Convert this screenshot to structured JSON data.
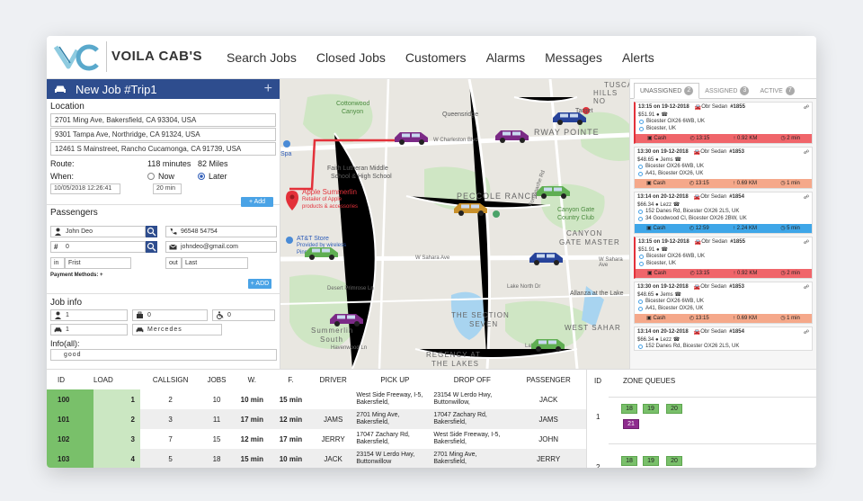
{
  "brand": "VOILA CAB'S",
  "nav": [
    "Search Jobs",
    "Closed Jobs",
    "Customers",
    "Alarms",
    "Messages",
    "Alerts"
  ],
  "newjob": {
    "title": "New Job #Trip1",
    "location_label": "Location",
    "addresses": [
      "2701 Ming Ave, Bakersfield, CA 93304, USA",
      "9301 Tampa Ave, Northridge, CA 91324, USA",
      "12461 S Mainstreet, Rancho Cucamonga, CA 91739, USA"
    ],
    "route_label": "Route:",
    "route_minutes": "118 minutes",
    "route_miles": "82 Miles",
    "when_label": "When:",
    "now_label": "Now",
    "later_label": "Later",
    "datetime": "10/05/2018  12:26:41",
    "minutes": "20 min",
    "add_label": "+ Add",
    "passengers_label": "Passengers",
    "name": "John Deo",
    "phone": "96548 54754",
    "count": "0",
    "email": "johndeo@gmail.com",
    "in_label": "in",
    "in_value": "Frist",
    "out_label": "out",
    "out_value": "Last",
    "payment_label": "Payment Methods: +",
    "add2_label": "+ ADD",
    "jobinfo_label": "Job info",
    "jobinfo_person": "1",
    "jobinfo_bag": "0",
    "jobinfo_wheel": "0",
    "jobinfo_car": "1",
    "jobinfo_model": "Mercedes",
    "info_label": "Info(all):",
    "info_value": "good"
  },
  "map": {
    "labels": [
      "TUSCA",
      "HILLS NO",
      "Cottonwood",
      "Canyon",
      "Queensridge",
      "Target",
      "RWAY POINTE",
      "W Charleston Blvd",
      "Faith Lutheran Middle",
      "School & High School",
      "PECCOLE RANCH",
      "Canyon Gate",
      "Country Club",
      "CANYON",
      "GATE MASTER",
      "Apple Summerlin",
      "Retailer of Apple",
      "products & accessories",
      "AT&T Store",
      "W Sahara Ave",
      "Desert Primrose Ln",
      "Lake North Dr",
      "Allanza at the Lake",
      "THE SECTION",
      "SEVEN",
      "WEST SAHAR",
      "Summerlin",
      "South",
      "Havenwood Ln",
      "REGENCY AT",
      "THE LAKES",
      "Lake South Dr",
      "Spa",
      "Fort Apache Rd",
      "Provided by wireless",
      "Pinnacle"
    ]
  },
  "tabs": [
    {
      "label": "UNASSIGNED",
      "count": "2"
    },
    {
      "label": "ASSIGNED",
      "count": "3"
    },
    {
      "label": "ACTIVE",
      "count": "7"
    }
  ],
  "cards": [
    {
      "time": "13:15 on 19-12-2018",
      "car": "Obr Sedan",
      "num": "#1855",
      "price": "$51.91",
      "p1": "Bicester OX26 6WB, UK",
      "p2": "Bicester, UK",
      "pay": "Cash",
      "eta": "13:15",
      "dist": "0.92 KM",
      "dur": "2 min",
      "color": "red"
    },
    {
      "time": "13:30 on 19-12-2018",
      "car": "Obr Sedan",
      "num": "#1853",
      "price": "$48.65",
      "who": "Jems",
      "p1": "Bicester OX26 6WB, UK",
      "p2": "A41, Bicester OX26, UK",
      "pay": "Cash",
      "eta": "13:15",
      "dist": "0.69 KM",
      "dur": "1 min",
      "color": "orange"
    },
    {
      "time": "13:14 on 20-12-2018",
      "car": "Obr Sedan",
      "num": "#1854",
      "price": "$66.34",
      "who": "Lezz",
      "p1": "152 Danes Rd, Bicester OX26 2LS, UK",
      "p2": "34 Goodwood Cl, Bicester OX26 2BW, UK",
      "pay": "Cash",
      "eta": "12:59",
      "dist": "2.24 KM",
      "dur": "5 min",
      "color": "blue"
    },
    {
      "time": "13:15 on 19-12-2018",
      "car": "Obr Sedan",
      "num": "#1855",
      "price": "$51.91",
      "p1": "Bicester OX26 6WB, UK",
      "p2": "Bicester, UK",
      "pay": "Cash",
      "eta": "13:15",
      "dist": "0.92 KM",
      "dur": "2 min",
      "color": "red"
    },
    {
      "time": "13:30 on 19-12-2018",
      "car": "Obr Sedan",
      "num": "#1853",
      "price": "$48.65",
      "who": "Jems",
      "p1": "Bicester OX26 6WB, UK",
      "p2": "A41, Bicester OX26, UK",
      "pay": "Cash",
      "eta": "13:15",
      "dist": "0.69 KM",
      "dur": "1 min",
      "color": "orange"
    },
    {
      "time": "13:14 on 20-12-2018",
      "car": "Obr Sedan",
      "num": "#1854",
      "price": "$66.34",
      "who": "Lezz",
      "p1": "152 Danes Rd, Bicester OX26 2LS, UK",
      "p2": "",
      "pay": "",
      "eta": "",
      "dist": "",
      "dur": "",
      "color": "none"
    }
  ],
  "table": {
    "headers": [
      "ID",
      "LOAD",
      "CALLSIGN",
      "JOBS",
      "W.",
      "F.",
      "DRIVER",
      "PICK UP",
      "DROP OFF",
      "PASSENGER"
    ],
    "rows": [
      {
        "id": "100",
        "load": "1",
        "callsign": "2",
        "jobs": "10",
        "w": "10 min",
        "f": "15 min",
        "driver": "",
        "pickup": "West Side Freeway, I-5, Bakersfield,",
        "dropoff": "23154 W Lerdo Hwy, Buttonwillow,",
        "passenger": "JACK"
      },
      {
        "id": "101",
        "load": "2",
        "callsign": "3",
        "jobs": "11",
        "w": "17 min",
        "f": "12 min",
        "driver": "JAMS",
        "pickup": "2701 Ming Ave, Bakersfield,",
        "dropoff": "17047 Zachary Rd, Bakersfield,",
        "passenger": "JAMS"
      },
      {
        "id": "102",
        "load": "3",
        "callsign": "7",
        "jobs": "15",
        "w": "12 min",
        "f": "17 min",
        "driver": "JERRY",
        "pickup": "17047 Zachary Rd, Bakersfield,",
        "dropoff": "West Side Freeway, I-5, Bakersfield,",
        "passenger": "JOHN"
      },
      {
        "id": "103",
        "load": "4",
        "callsign": "5",
        "jobs": "18",
        "w": "15 min",
        "f": "10 min",
        "driver": "JACK",
        "pickup": "23154 W Lerdo Hwy, Buttonwillow",
        "dropoff": "2701 Ming Ave, Bakersfield,",
        "passenger": "JERRY"
      }
    ]
  },
  "zones": {
    "id_header": "ID",
    "title": "ZONE QUEUES",
    "rows": [
      {
        "id": "1",
        "chips": [
          "18",
          "19",
          "20"
        ],
        "extra": "21"
      },
      {
        "id": "2",
        "chips": [
          "18",
          "19",
          "20"
        ],
        "extra": ""
      }
    ]
  },
  "colors": {
    "primary": "#2e4d8e",
    "green": "#79c06a",
    "red": "#f0656a",
    "orange": "#f5a88a",
    "blue": "#3ea6e8",
    "route": "#e3313a"
  }
}
